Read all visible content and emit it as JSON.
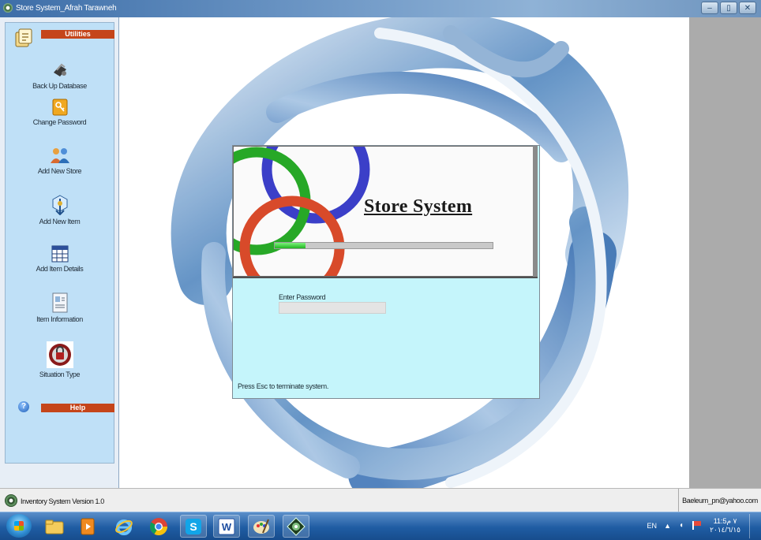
{
  "window": {
    "title": "Store System_Afrah Tarawneh",
    "buttons": {
      "minimize": "–",
      "maximize": "▯",
      "close": "✕"
    }
  },
  "sidebar": {
    "utilities_header": "Utilities",
    "help_header": "Help",
    "items": [
      {
        "label": "Back Up Database",
        "icon": "backup-icon"
      },
      {
        "label": "Change Password",
        "icon": "key-icon"
      },
      {
        "label": "Add New Store",
        "icon": "users-icon"
      },
      {
        "label": "Add New Item",
        "icon": "item-icon"
      },
      {
        "label": "Add Item Details",
        "icon": "table-icon"
      },
      {
        "label": "Item Information",
        "icon": "id-card-icon"
      },
      {
        "label": "Situation Type",
        "icon": "badge-icon"
      }
    ]
  },
  "dialog": {
    "banner_title": "Store System",
    "progress_fraction": 0.14,
    "password_label": "Enter Password",
    "password_value": "",
    "esc_hint": "Press Esc to terminate system."
  },
  "statusbar": {
    "version": "Inventory System Version 1.0",
    "email": "Baeleum_pn@yahoo.com"
  },
  "taskbar": {
    "apps": [
      "explorer-icon",
      "media-icon",
      "ie-icon",
      "chrome-icon",
      "skype-icon",
      "word-icon",
      "paint-icon",
      "store-system-icon"
    ],
    "language": "EN",
    "time": "11:5٧ م",
    "date": "٢٠١٤/٦/١٥"
  },
  "colors": {
    "section_bar": "#c5451a",
    "dialog_bg": "#c5f5fb",
    "sidebar_bg": "#bfe0f7",
    "taskbar": "#1f5ca3"
  }
}
